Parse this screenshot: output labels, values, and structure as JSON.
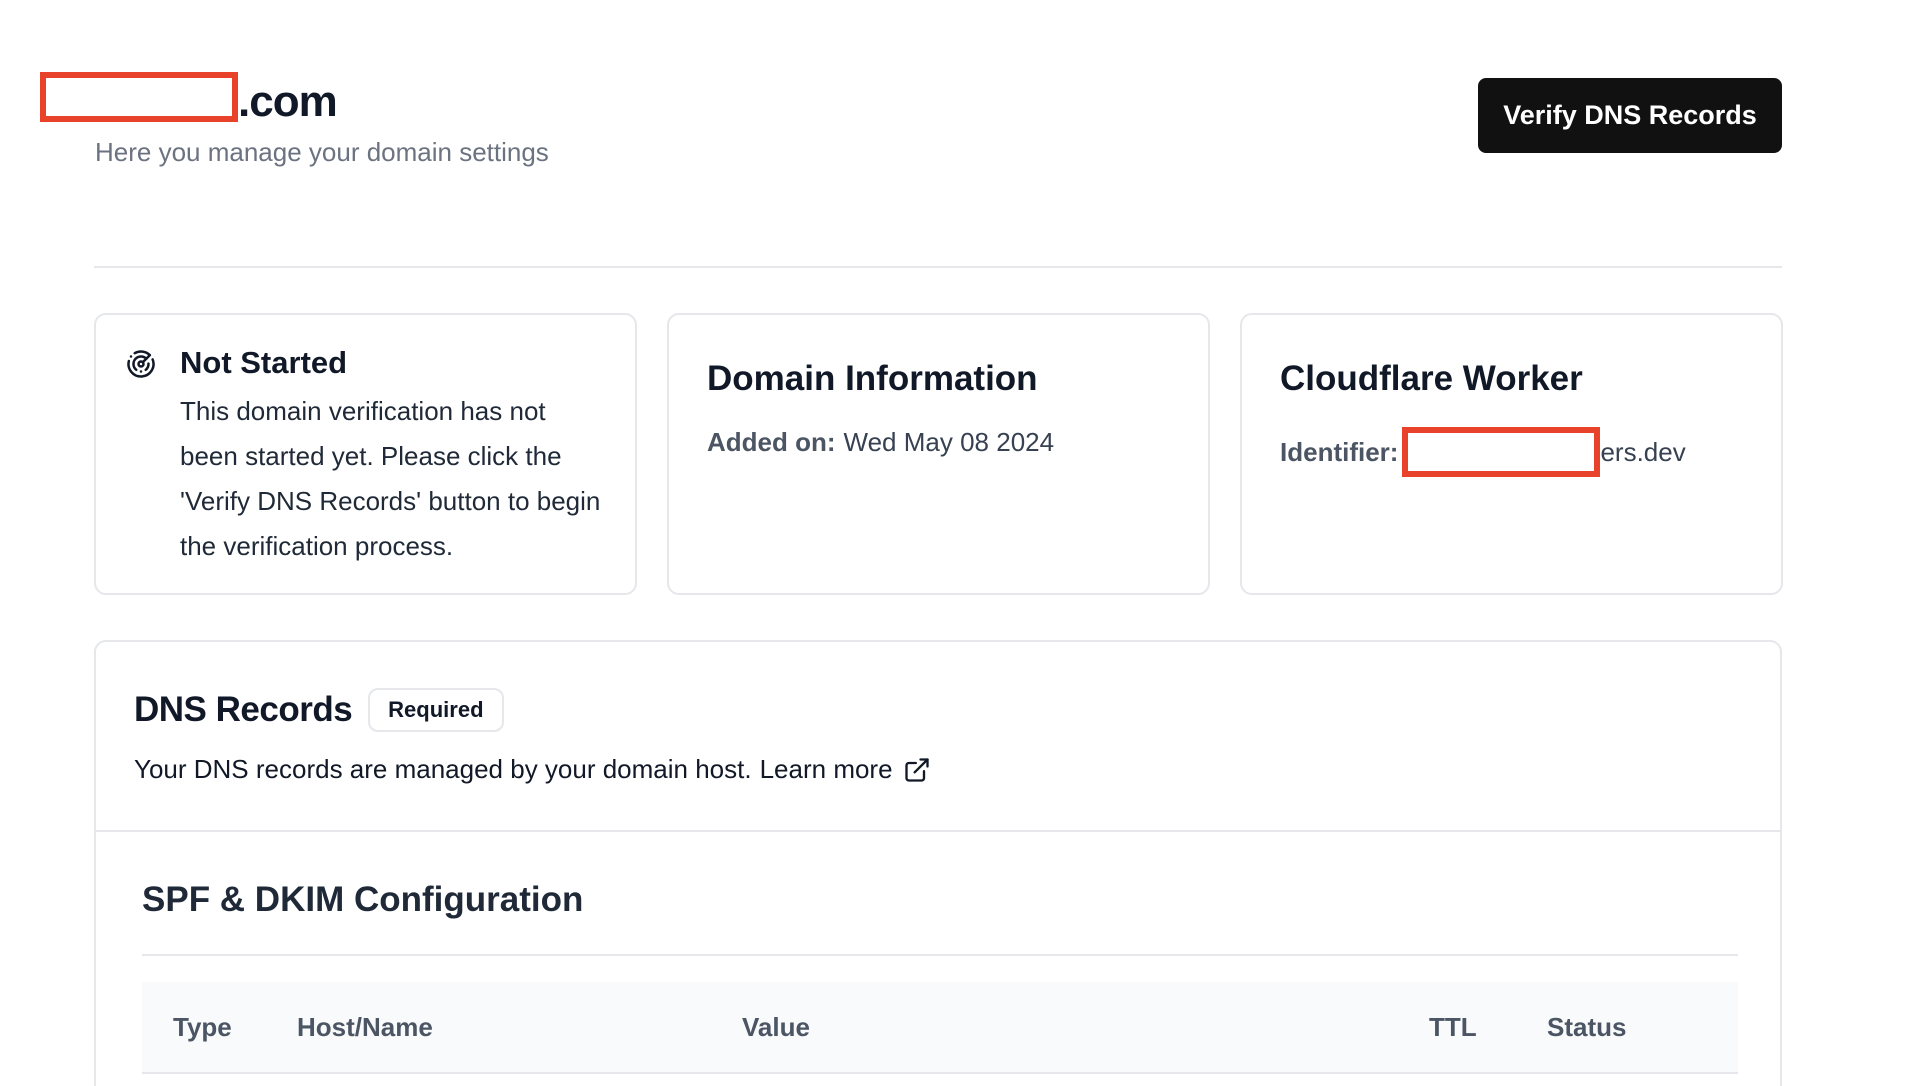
{
  "header": {
    "domain_suffix": ".com",
    "subtitle": "Here you manage your domain settings",
    "verify_button": "Verify DNS Records"
  },
  "status_card": {
    "icon": "radar-icon",
    "title": "Not Started",
    "text": "This domain verification has not been started yet. Please click the 'Verify DNS Records' button to begin the verification process."
  },
  "domain_card": {
    "title": "Domain Information",
    "added_label": "Added on:",
    "added_value": "Wed May 08 2024"
  },
  "worker_card": {
    "title": "Cloudflare Worker",
    "identifier_label": "Identifier:",
    "identifier_suffix": "ers.dev"
  },
  "dns": {
    "title": "DNS Records",
    "badge": "Required",
    "description": "Your DNS records are managed by your domain host.",
    "learn_more": "Learn more",
    "section_title": "SPF & DKIM Configuration",
    "columns": [
      "Type",
      "Host/Name",
      "Value",
      "TTL",
      "Status"
    ]
  },
  "colors": {
    "redaction": "#e8432a",
    "button_bg": "#111111",
    "border": "#e5e7eb",
    "muted_text": "#6b7280"
  }
}
